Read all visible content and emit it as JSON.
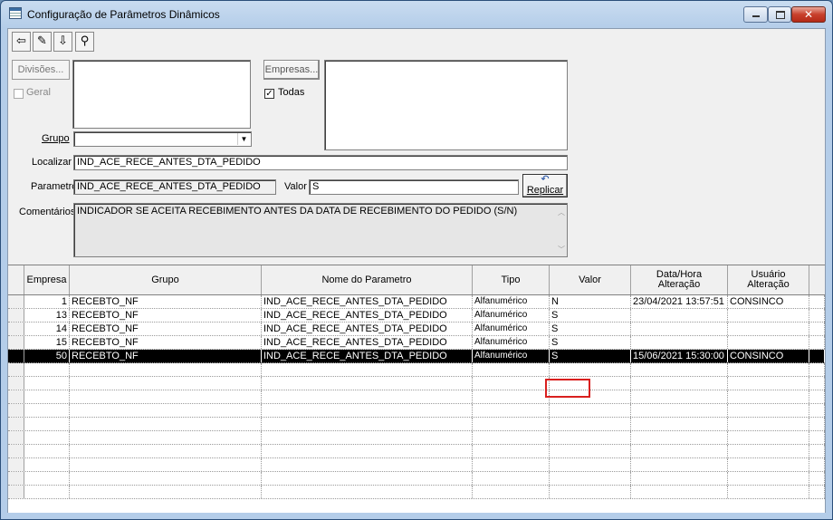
{
  "window": {
    "title": "Configuração de Parâmetros Dinâmicos"
  },
  "toolbar": {
    "icons": [
      "exit-icon",
      "edit-icon",
      "save-icon",
      "search-icon"
    ]
  },
  "divisoes_button": "Divisões...",
  "geral_label": "Geral",
  "empresas_button": "Empresas...",
  "todas_label": "Todas",
  "todas_checked": true,
  "grupo_label": "Grupo",
  "grupo_value": "",
  "localizar_label": "Localizar",
  "localizar_value": "IND_ACE_RECE_ANTES_DTA_PEDIDO",
  "parametro_label": "Parametro",
  "parametro_value": "IND_ACE_RECE_ANTES_DTA_PEDIDO",
  "valor_label": "Valor",
  "valor_value": "S",
  "replicar_label": "Replicar",
  "comentarios_label": "Comentários",
  "comentarios_value": "INDICADOR SE ACEITA RECEBIMENTO ANTES DA DATA DE RECEBIMENTO DO PEDIDO (S/N)",
  "grid": {
    "headers": {
      "empresa": "Empresa",
      "grupo": "Grupo",
      "nome": "Nome do Parametro",
      "tipo": "Tipo",
      "valor": "Valor",
      "data_1": "Data/Hora",
      "data_2": "Alteração",
      "usuario_1": "Usuário",
      "usuario_2": "Alteração"
    },
    "rows": [
      {
        "empresa": "1",
        "grupo": "RECEBTO_NF",
        "nome": "IND_ACE_RECE_ANTES_DTA_PEDIDO",
        "tipo": "Alfanumérico",
        "valor": "N",
        "data": "23/04/2021 13:57:51",
        "usuario": "CONSINCO"
      },
      {
        "empresa": "13",
        "grupo": "RECEBTO_NF",
        "nome": "IND_ACE_RECE_ANTES_DTA_PEDIDO",
        "tipo": "Alfanumérico",
        "valor": "S",
        "data": "",
        "usuario": ""
      },
      {
        "empresa": "14",
        "grupo": "RECEBTO_NF",
        "nome": "IND_ACE_RECE_ANTES_DTA_PEDIDO",
        "tipo": "Alfanumérico",
        "valor": "S",
        "data": "",
        "usuario": ""
      },
      {
        "empresa": "15",
        "grupo": "RECEBTO_NF",
        "nome": "IND_ACE_RECE_ANTES_DTA_PEDIDO",
        "tipo": "Alfanumérico",
        "valor": "S",
        "data": "",
        "usuario": ""
      },
      {
        "empresa": "50",
        "grupo": "RECEBTO_NF",
        "nome": "IND_ACE_RECE_ANTES_DTA_PEDIDO",
        "tipo": "Alfanumérico",
        "valor": "S",
        "data": "15/06/2021 15:30:00",
        "usuario": "CONSINCO",
        "selected": true
      }
    ]
  },
  "colors": {
    "highlight": "#d9201f",
    "selected_row": "#000000"
  }
}
